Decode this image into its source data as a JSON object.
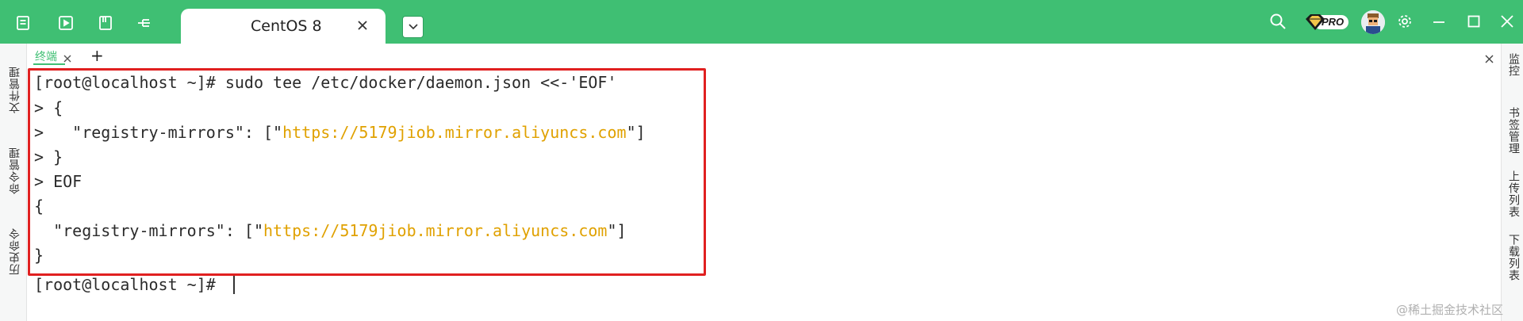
{
  "window": {
    "tab_title": "CentOS 8",
    "pro_label": "PRO"
  },
  "subtab": {
    "label": "终端",
    "add": "+"
  },
  "left_panel": [
    "文件管理",
    "命令管理",
    "历史命令"
  ],
  "right_panel": [
    "监控",
    "书签管理",
    "上传列表",
    "下载列表"
  ],
  "terminal": {
    "lines": [
      "[root@localhost ~]# sudo tee /etc/docker/daemon.json <<-'EOF'",
      "> {",
      ">   \"registry-mirrors\": [\"",
      "> }",
      "> EOF",
      "{",
      "  \"registry-mirrors\": [\"",
      "}",
      "[root@localhost ~]# "
    ],
    "mirror_url": "https://5179jiob.mirror.aliyuncs.com",
    "closing": "\"]"
  },
  "watermark": "@稀土掘金技术社区",
  "colors": {
    "topbar": "#3fbf73",
    "url": "#e0a100",
    "highlight_border": "#e02020"
  },
  "icons": [
    "terminal-list-icon",
    "play-icon",
    "notebook-icon",
    "split-icon",
    "close-icon",
    "chevron-down-icon",
    "search-icon",
    "vip-badge-icon",
    "avatar",
    "gear-icon",
    "minimize-icon",
    "maximize-icon",
    "window-close-icon"
  ]
}
